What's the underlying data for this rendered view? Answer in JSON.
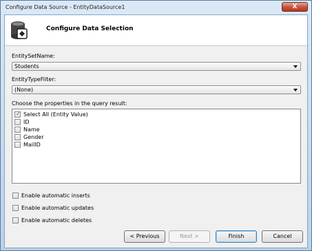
{
  "window": {
    "title": "Configure Data Source - EntityDataSource1",
    "close_glyph": "X"
  },
  "header": {
    "title": "Configure Data Selection",
    "icon": "database-wizard-icon"
  },
  "entity_set": {
    "label": "EntitySetName:",
    "value": "Students"
  },
  "entity_type_filter": {
    "label": "EntityTypeFilter:",
    "value": "(None)"
  },
  "properties": {
    "label": "Choose the properties in the query result:",
    "items": [
      {
        "label": "Select All (Entity Value)",
        "checked": true
      },
      {
        "label": "ID",
        "checked": false
      },
      {
        "label": "Name",
        "checked": false
      },
      {
        "label": "Gender",
        "checked": false
      },
      {
        "label": "MailID",
        "checked": false
      }
    ]
  },
  "options": [
    {
      "label": "Enable automatic inserts",
      "checked": false
    },
    {
      "label": "Enable automatic updates",
      "checked": false
    },
    {
      "label": "Enable automatic deletes",
      "checked": false
    }
  ],
  "buttons": {
    "previous": "< Previous",
    "next": "Next >",
    "finish": "Finish",
    "cancel": "Cancel"
  }
}
